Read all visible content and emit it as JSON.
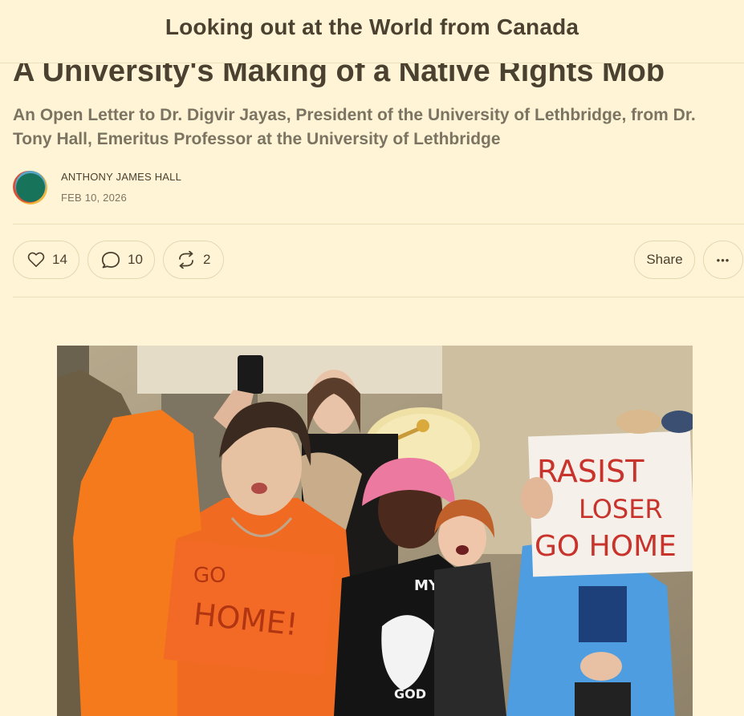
{
  "header": {
    "publication": "Looking out at the World from Canada"
  },
  "post": {
    "title": "A University's Making of a Native Rights Mob",
    "subtitle": "An Open Letter to Dr. Digvir Jayas, President of the University of Lethbridge, from Dr. Tony Hall, Emeritus Professor at the University of Lethbridge",
    "author": "ANTHONY JAMES HALL",
    "date": "FEB 10, 2026"
  },
  "actions": {
    "likes": "14",
    "comments": "10",
    "restacks": "2",
    "share_label": "Share",
    "more_label": "•••"
  },
  "image": {
    "sign_left": [
      "GO",
      "HOME!"
    ],
    "sign_right": [
      "RASIST",
      "LOSER",
      "GO HOME"
    ],
    "shirt_text": [
      "MY!",
      "GOD"
    ]
  },
  "colors": {
    "background": "#fff5d6",
    "text": "#4a4130",
    "muted": "#7c7462",
    "border": "#e3d7b2"
  },
  "icons": {
    "like": "heart-icon",
    "comment": "speech-bubble-icon",
    "restack": "restack-arrows-icon",
    "more": "ellipsis-icon",
    "avatar": "avatar-logo-icon"
  }
}
